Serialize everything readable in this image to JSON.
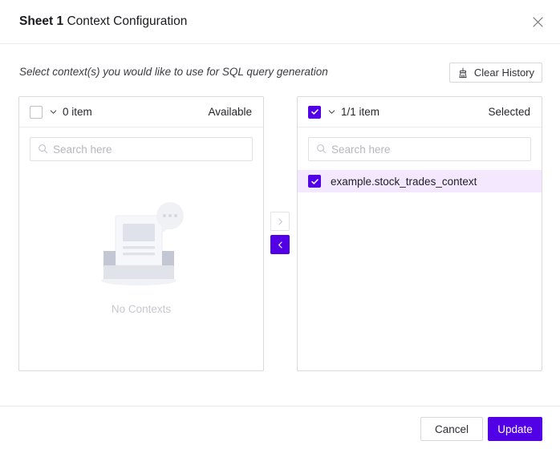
{
  "dialog": {
    "title_bold": "Sheet 1",
    "title_rest": " Context Configuration",
    "close_icon": "close-icon",
    "subtitle": "Select context(s) you would like to use for SQL query generation",
    "clear_history": {
      "label": "Clear History",
      "icon": "broom-icon"
    }
  },
  "panels": {
    "available": {
      "side_label": "Available",
      "count_label": "0 item",
      "checkbox_checked": false,
      "chevron_icon": "chevron-down-icon",
      "search": {
        "placeholder": "Search here",
        "value": "",
        "icon": "search-icon"
      },
      "empty_state": {
        "text": "No Contexts",
        "illustration": "empty-inbox-illustration"
      },
      "items": []
    },
    "selected": {
      "side_label": "Selected",
      "count_label": "1/1 item",
      "checkbox_checked": true,
      "chevron_icon": "chevron-down-icon",
      "search": {
        "placeholder": "Search here",
        "value": "",
        "icon": "search-icon"
      },
      "items": [
        {
          "label": "example.stock_trades_context",
          "checked": true
        }
      ]
    }
  },
  "transfer": {
    "move_right_icon": "chevron-right-icon",
    "move_left_icon": "chevron-left-icon",
    "move_right_enabled": false,
    "move_left_enabled": true
  },
  "footer": {
    "cancel_label": "Cancel",
    "update_label": "Update"
  },
  "colors": {
    "accent": "#5200e5",
    "selected_row_bg": "#f3e8fd",
    "border": "#d9d9de",
    "muted_text": "#c6c8d0"
  }
}
